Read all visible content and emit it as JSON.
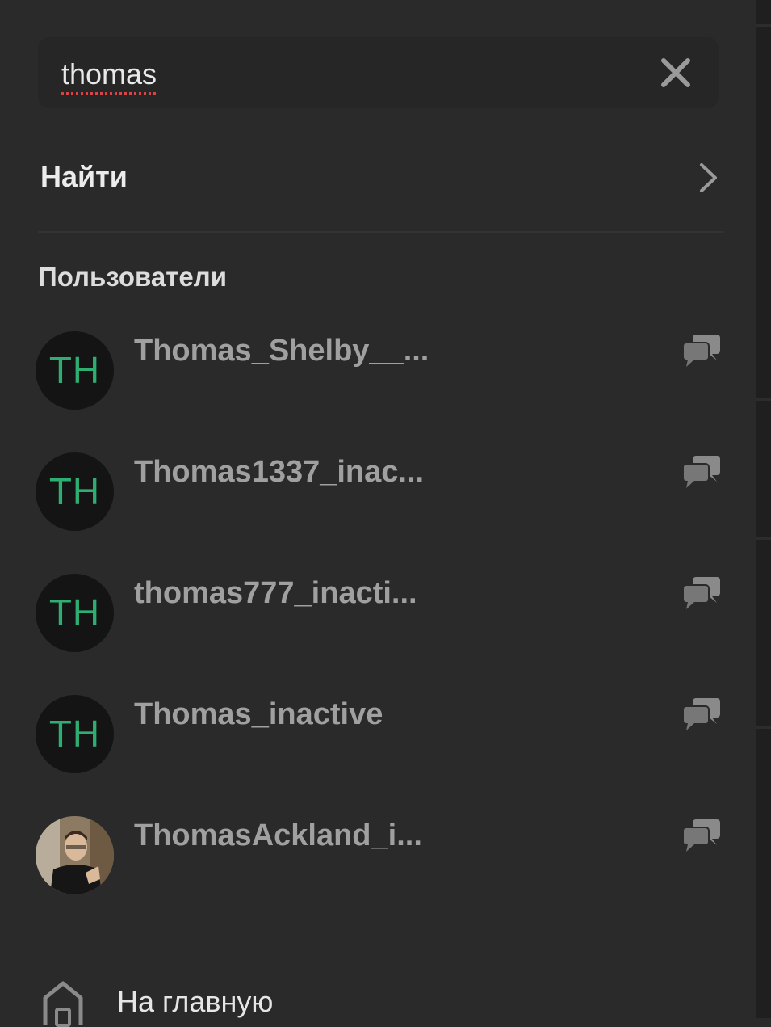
{
  "search": {
    "value": "thomas",
    "clear_icon": "close-icon"
  },
  "find": {
    "label": "Найти",
    "icon": "chevron-right-icon"
  },
  "users_section": {
    "title": "Пользователи",
    "users": [
      {
        "initials": "TH",
        "name": "Thomas_Shelby__...",
        "has_photo": false
      },
      {
        "initials": "TH",
        "name": "Thomas1337_inac...",
        "has_photo": false
      },
      {
        "initials": "TH",
        "name": "thomas777_inacti...",
        "has_photo": false
      },
      {
        "initials": "TH",
        "name": "Thomas_inactive",
        "has_photo": false
      },
      {
        "initials": "",
        "name": "ThomasAckland_i...",
        "has_photo": true
      }
    ]
  },
  "nav": {
    "home_label": "На главную",
    "home_icon": "home-icon"
  },
  "colors": {
    "background": "#2a2a2b",
    "avatar_bg": "#141414",
    "initials": "#2fae72",
    "username": "#a0a0a0",
    "spell_underline": "#d94545"
  }
}
